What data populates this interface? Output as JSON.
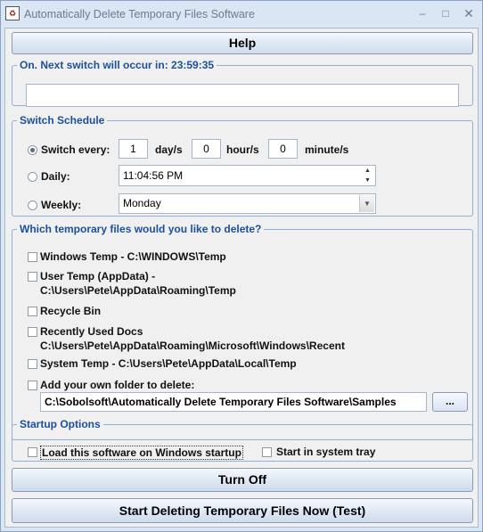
{
  "window": {
    "title": "Automatically Delete Temporary Files Software",
    "icon_name": "recycle-icon",
    "minimize": "–",
    "maximize": "□",
    "close": "✕"
  },
  "help_button": "Help",
  "status_group": {
    "legend": "On. Next switch will occur in: 23:59:35",
    "field_value": ""
  },
  "schedule": {
    "legend": "Switch Schedule",
    "switch_every": {
      "label": "Switch every:",
      "selected": true,
      "days": "1",
      "days_unit": "day/s",
      "hours": "0",
      "hours_unit": "hour/s",
      "minutes": "0",
      "minutes_unit": "minute/s"
    },
    "daily": {
      "label": "Daily:",
      "selected": false,
      "time": "11:04:56 PM"
    },
    "weekly": {
      "label": "Weekly:",
      "selected": false,
      "day": "Monday"
    }
  },
  "files_group": {
    "legend": "Which temporary files would you like to delete?",
    "options": [
      {
        "line1": "Windows Temp - C:\\WINDOWS\\Temp",
        "line2": "",
        "checked": false
      },
      {
        "line1": "User Temp (AppData) -",
        "line2": "C:\\Users\\Pete\\AppData\\Roaming\\Temp",
        "checked": false
      },
      {
        "line1": "Recycle Bin",
        "line2": "",
        "checked": false
      },
      {
        "line1": "Recently Used Docs",
        "line2": "C:\\Users\\Pete\\AppData\\Roaming\\Microsoft\\Windows\\Recent",
        "checked": false
      },
      {
        "line1": "System Temp - C:\\Users\\Pete\\AppData\\Local\\Temp",
        "line2": "",
        "checked": false
      },
      {
        "line1": "Add your own folder to delete:",
        "line2": "",
        "checked": false
      }
    ],
    "custom_folder": "C:\\Sobolsoft\\Automatically Delete Temporary Files Software\\Samples",
    "browse_label": "..."
  },
  "startup": {
    "legend": "Startup Options",
    "load_on_startup": {
      "label": "Load this software on Windows startup",
      "checked": false
    },
    "system_tray": {
      "label": "Start in system tray",
      "checked": false
    }
  },
  "turn_off_button": "Turn Off",
  "start_button": "Start Deleting Temporary Files Now (Test)"
}
